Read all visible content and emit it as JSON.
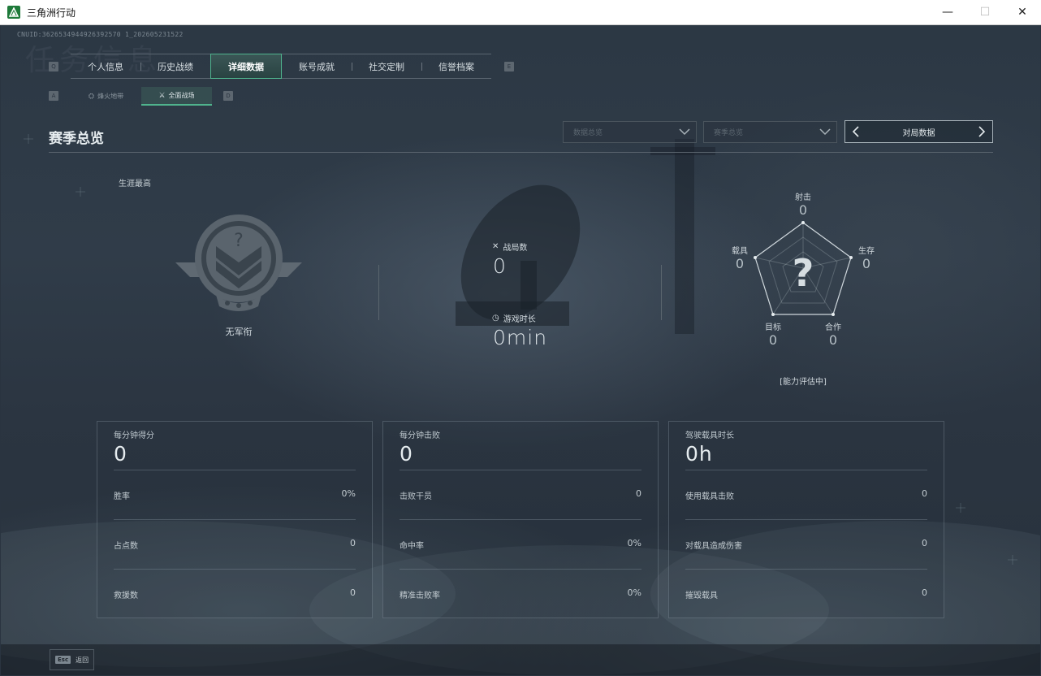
{
  "window": {
    "title": "三角洲行动",
    "minimize": "—",
    "maximize": "☐",
    "close": "✕"
  },
  "header": {
    "uid": "CNUID:3626534944926392570 1_202605231522",
    "watermark": "任务信息"
  },
  "main_tabs": {
    "prev_key": "Q",
    "next_key": "E",
    "items": [
      {
        "label": "个人信息",
        "active": false
      },
      {
        "label": "历史战绩",
        "active": false
      },
      {
        "label": "详细数据",
        "active": true
      },
      {
        "label": "账号成就",
        "active": false
      },
      {
        "label": "社交定制",
        "active": false
      },
      {
        "label": "信誉档案",
        "active": false
      }
    ]
  },
  "sub_tabs": {
    "prev_key": "A",
    "next_key": "D",
    "items": [
      {
        "label": "烽火地带",
        "active": false,
        "icon": "hazard-icon"
      },
      {
        "label": "全面战场",
        "active": true,
        "icon": "battlefield-icon"
      }
    ]
  },
  "section": {
    "title": "赛季总览",
    "dropdown1": "数据总览",
    "dropdown2": "赛季总览",
    "pager_label": "对局数据"
  },
  "career": {
    "label": "生涯最高",
    "rank_name": "无军衔",
    "rank_symbol": "?"
  },
  "stats": {
    "matches_label": "战局数",
    "matches_value": "0",
    "playtime_label": "游戏时长",
    "playtime_value": "0min"
  },
  "radar": {
    "axes": [
      {
        "label": "射击",
        "value": "0"
      },
      {
        "label": "生存",
        "value": "0"
      },
      {
        "label": "合作",
        "value": "0"
      },
      {
        "label": "目标",
        "value": "0"
      },
      {
        "label": "载具",
        "value": "0"
      }
    ],
    "center_symbol": "?",
    "status": "[能力评估中]"
  },
  "cards": [
    {
      "title": "每分钟得分",
      "main": "0",
      "rows": [
        {
          "label": "胜率",
          "value": "0%"
        },
        {
          "label": "占点数",
          "value": "0"
        },
        {
          "label": "救援数",
          "value": "0"
        }
      ]
    },
    {
      "title": "每分钟击败",
      "main": "0",
      "rows": [
        {
          "label": "击败干员",
          "value": "0"
        },
        {
          "label": "命中率",
          "value": "0%"
        },
        {
          "label": "精准击败率",
          "value": "0%"
        }
      ]
    },
    {
      "title": "驾驶载具时长",
      "main": "0h",
      "rows": [
        {
          "label": "使用载具击败",
          "value": "0"
        },
        {
          "label": "对载具造成伤害",
          "value": "0"
        },
        {
          "label": "摧毁载具",
          "value": "0"
        }
      ]
    }
  ],
  "footer": {
    "esc_key": "Esc",
    "back_label": "返回"
  },
  "colors": {
    "accent": "#4fb38d",
    "background": "#2c3844",
    "text": "#c9d3d8"
  }
}
